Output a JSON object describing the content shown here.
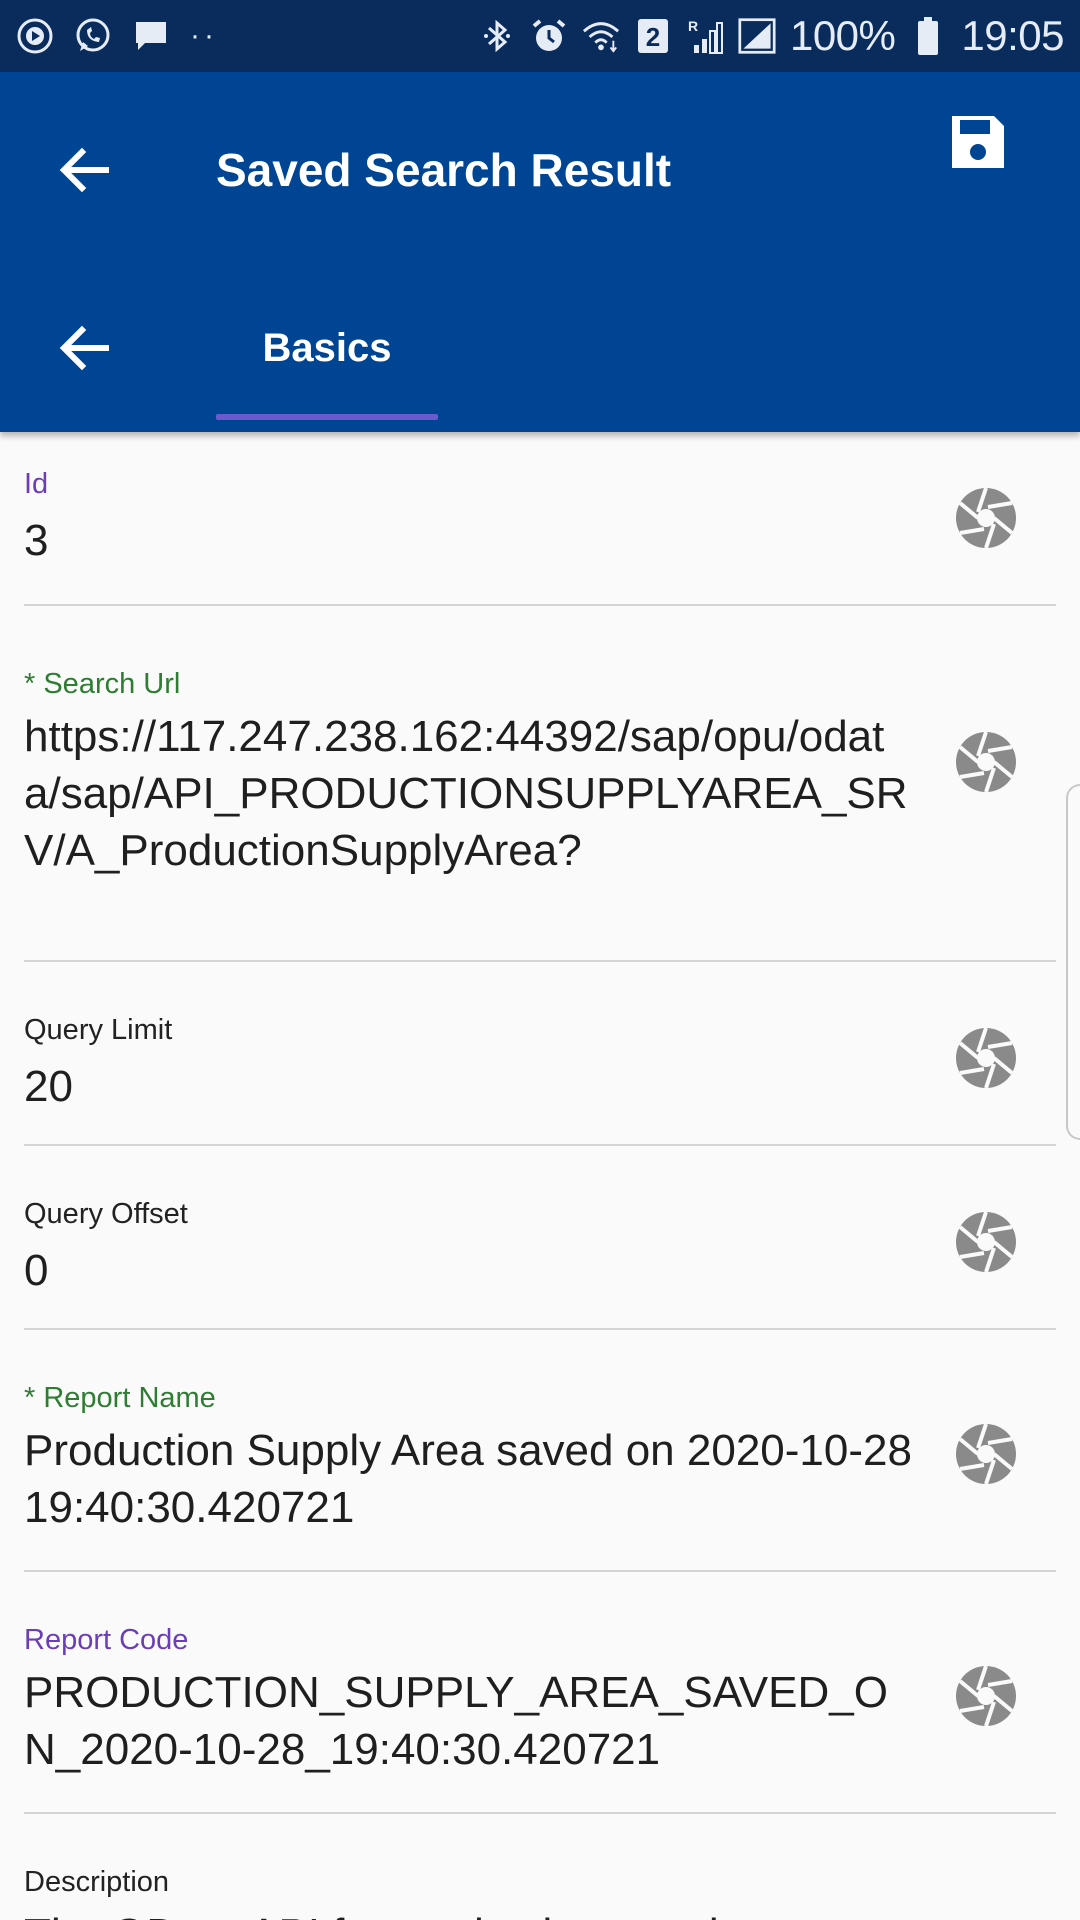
{
  "status_bar": {
    "left_icons": [
      "play-circle-icon",
      "whatsapp-icon",
      "message-icon",
      "more-dots-icon"
    ],
    "right_icons": [
      "bluetooth-icon",
      "alarm-icon",
      "wifi-icon",
      "sim-2-icon",
      "roaming-signal-icon",
      "signal-icon",
      "battery-icon"
    ],
    "sim_badge": "2",
    "roaming_label": "R",
    "battery": "100%",
    "time": "19:05"
  },
  "app_bar": {
    "title": "Saved Search Result",
    "back_icon": "arrow-left-icon",
    "save_icon": "floppy-save-icon"
  },
  "tab_bar": {
    "back_icon": "arrow-left-icon",
    "tabs": [
      {
        "label": "Basics",
        "active": true
      }
    ]
  },
  "fields": [
    {
      "label": "Id",
      "value": "3",
      "label_color": "purple",
      "action_icon": "aperture-icon"
    },
    {
      "label": "* Search Url",
      "value": "https://117.247.238.162:44392/sap/opu/odata/sap/API_PRODUCTIONSUPPLYAREA_SRV/A_ProductionSupplyArea?",
      "label_color": "green",
      "action_icon": "aperture-icon"
    },
    {
      "label": "Query Limit",
      "value": "20",
      "label_color": "default",
      "action_icon": "aperture-icon"
    },
    {
      "label": "Query Offset",
      "value": "0",
      "label_color": "default",
      "action_icon": "aperture-icon"
    },
    {
      "label": "* Report Name",
      "value": "Production Supply Area saved on 2020-10-28 19:40:30.420721",
      "label_color": "green",
      "action_icon": "aperture-icon"
    },
    {
      "label": "Report Code",
      "value": "PRODUCTION_SUPPLY_AREA_SAVED_ON_2020-10-28_19:40:30.420721",
      "label_color": "purple",
      "action_icon": "aperture-icon"
    },
    {
      "label": "Description",
      "value": "The OData API for production supply area",
      "label_color": "default",
      "action_icon": ""
    }
  ],
  "colors": {
    "status_bar_bg": "#0a2c5c",
    "app_bar_bg": "#004593",
    "tab_indicator": "#6a5acd",
    "label_purple": "#6a3fb5",
    "label_green": "#2e7d32",
    "icon_gray": "#8a8a8a"
  }
}
